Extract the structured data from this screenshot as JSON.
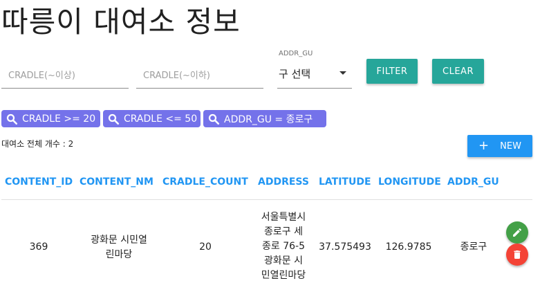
{
  "page": {
    "title": "따릉이 대여소 정보"
  },
  "filters": {
    "cradle_min_placeholder": "CRADLE(~이상)",
    "cradle_max_placeholder": "CRADLE(~이하)",
    "addr_gu_label": "ADDR_GU",
    "addr_gu_value": "구 선택",
    "filter_label": "FILTER",
    "clear_label": "CLEAR"
  },
  "chips": [
    {
      "label": "CRADLE >= 20"
    },
    {
      "label": "CRADLE <= 50"
    },
    {
      "label": "ADDR_GU = 종로구"
    }
  ],
  "total_text": "대여소 전체 개수 : 2",
  "new_button": {
    "plus": "+",
    "label": "NEW"
  },
  "table": {
    "columns": [
      "CONTENT_ID",
      "CONTENT_NM",
      "CRADLE_COUNT",
      "ADDRESS",
      "LATITUDE",
      "LONGITUDE",
      "ADDR_GU"
    ],
    "rows": [
      {
        "content_id": "369",
        "content_nm_lines": [
          "광화문 시민열",
          "린마당"
        ],
        "cradle_count": "20",
        "address_lines": [
          "서울특별시",
          "종로구 세",
          "종로 76-5",
          "광화문 시",
          "민열린마당"
        ],
        "latitude": "37.575493",
        "longitude": "126.9785",
        "addr_gu": "종로구"
      }
    ]
  },
  "icons": {
    "chip_icon": "search-icon",
    "edit_icon": "pencil-icon",
    "delete_icon": "trash-icon"
  },
  "colors": {
    "teal": "#26a69a",
    "chip": "#7472ea",
    "primary": "#2196f3",
    "edit": "#43a047",
    "delete": "#f44336"
  }
}
